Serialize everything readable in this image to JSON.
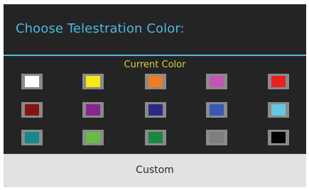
{
  "dialog": {
    "title": "Choose Telestration Color:",
    "current_color_label": "Current Color",
    "custom_button_label": "Custom"
  },
  "swatches": [
    {
      "name": "white",
      "color": "#ffffff"
    },
    {
      "name": "yellow",
      "color": "#f5ea16"
    },
    {
      "name": "orange",
      "color": "#f07c22"
    },
    {
      "name": "pink",
      "color": "#c455b3"
    },
    {
      "name": "red",
      "color": "#e8211e"
    },
    {
      "name": "maroon",
      "color": "#841316"
    },
    {
      "name": "purple",
      "color": "#86278f"
    },
    {
      "name": "navy",
      "color": "#2b2b86"
    },
    {
      "name": "blue",
      "color": "#3a57b8"
    },
    {
      "name": "light-blue",
      "color": "#63c8e3"
    },
    {
      "name": "teal",
      "color": "#14878f"
    },
    {
      "name": "green",
      "color": "#66bc45"
    },
    {
      "name": "dark-green",
      "color": "#1a8742"
    },
    {
      "name": "gray",
      "color": "#7e7e7e"
    },
    {
      "name": "black",
      "color": "#000000"
    }
  ]
}
